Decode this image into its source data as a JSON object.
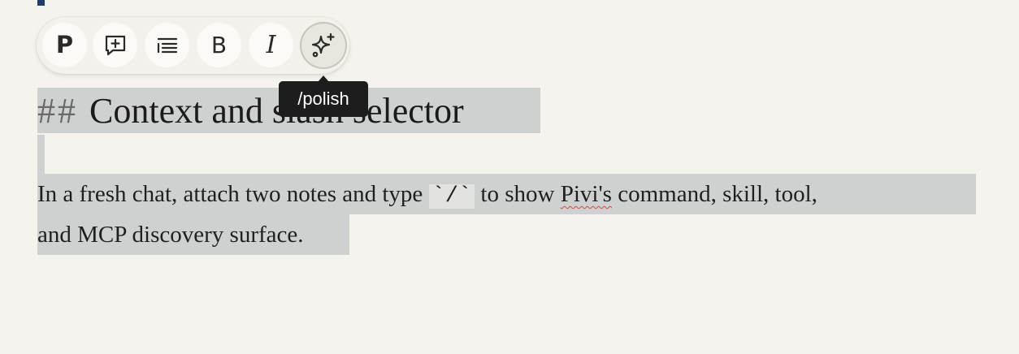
{
  "toolbar": {
    "paragraph_label": "P",
    "bold_label": "B",
    "italic_label": "I",
    "buttons": [
      {
        "name": "paragraph",
        "icon": "paragraph-p-icon"
      },
      {
        "name": "comment",
        "icon": "add-comment-icon"
      },
      {
        "name": "list",
        "icon": "list-icon"
      },
      {
        "name": "bold",
        "icon": "bold-icon"
      },
      {
        "name": "italic",
        "icon": "italic-icon"
      },
      {
        "name": "polish",
        "icon": "sparkles-icon",
        "active": true
      }
    ]
  },
  "tooltip": {
    "text": "/polish"
  },
  "document": {
    "heading_marker": "##",
    "heading_text": "Context and slash selector",
    "para_line1_a": "In a fresh chat, attach two notes and type ",
    "para_code": "`/`",
    "para_line1_b": " to show ",
    "para_misspelled": "Pivi's",
    "para_line1_c": " command, skill, tool,",
    "para_line2": "and MCP discovery surface."
  },
  "colors": {
    "background": "#f4f3ed",
    "selection": "#cfd0d0",
    "tooltip_bg": "#1d1d1d",
    "spellcheck": "#d24a4a"
  }
}
